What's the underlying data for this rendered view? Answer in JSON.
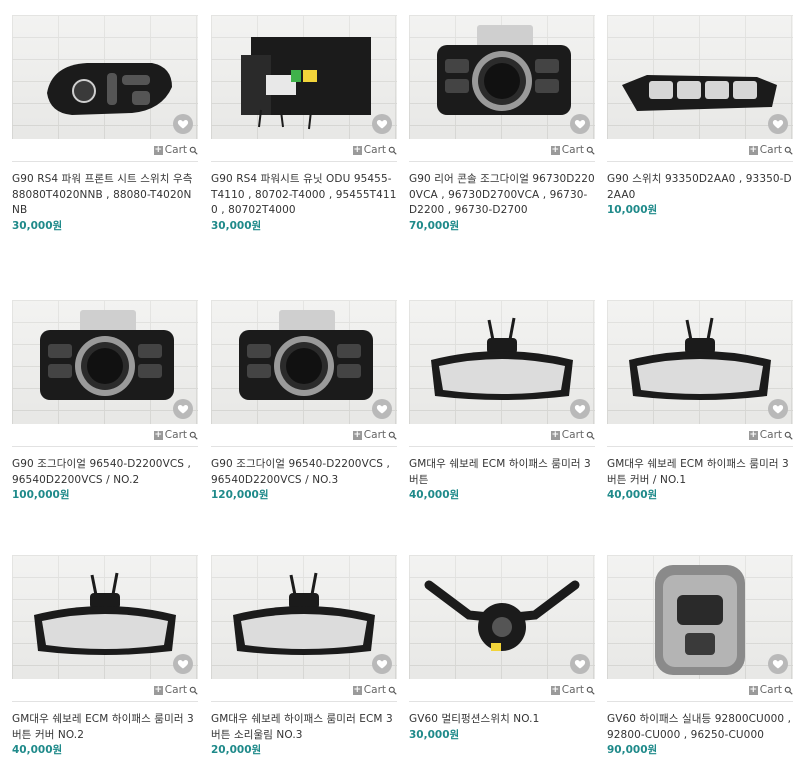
{
  "colors": {
    "price": "#1f8a8a",
    "heart_bg": "#b9b9b9",
    "text": "#333333"
  },
  "products": [
    {
      "title": "G90 RS4 파워 프론트 시트 스위치 우측 88080T4020NNB , 88080-T4020NNB",
      "price": "30,000원",
      "cart_label": "Cart",
      "icon": "seat-switch"
    },
    {
      "title": "G90 RS4 파워시트 유닛 ODU 95455-T4110 , 80702-T4000 , 95455T4110 , 80702T4000",
      "price": "30,000원",
      "cart_label": "Cart",
      "icon": "ecu-unit"
    },
    {
      "title": "G90 리어 콘솔 조그다이얼 96730D2200VCA , 96730D2700VCA , 96730-D2200 , 96730-D2700",
      "price": "70,000원",
      "cart_label": "Cart",
      "icon": "jog-dial"
    },
    {
      "title": "G90 스위치 93350D2AA0 , 93350-D2AA0",
      "price": "10,000원",
      "cart_label": "Cart",
      "icon": "switch-panel"
    },
    {
      "title": "G90 조그다이얼 96540-D2200VCS , 96540D2200VCS / NO.2",
      "price": "100,000원",
      "cart_label": "Cart",
      "icon": "jog-dial"
    },
    {
      "title": "G90 조그다이얼 96540-D2200VCS , 96540D2200VCS / NO.3",
      "price": "120,000원",
      "cart_label": "Cart",
      "icon": "jog-dial"
    },
    {
      "title": "GM대우 쉐보레 ECM 하이패스 룸미러 3버튼",
      "price": "40,000원",
      "cart_label": "Cart",
      "icon": "mirror"
    },
    {
      "title": "GM대우 쉐보레 ECM 하이패스 룸미러 3버튼 커버 / NO.1",
      "price": "40,000원",
      "cart_label": "Cart",
      "icon": "mirror"
    },
    {
      "title": "GM대우 쉐보레 ECM 하이패스 룸미러 3버튼 커버 NO.2",
      "price": "40,000원",
      "cart_label": "Cart",
      "icon": "mirror"
    },
    {
      "title": "GM대우 쉐보레 하이패스 룸미러 ECM 3버튼 소리울림 NO.3",
      "price": "20,000원",
      "cart_label": "Cart",
      "icon": "mirror"
    },
    {
      "title": "GV60 멀티펑션스위치 NO.1",
      "price": "30,000원",
      "cart_label": "Cart",
      "icon": "multifunction-switch"
    },
    {
      "title": "GV60 하이패스 실내등 92800CU000 , 92800-CU000 , 96250-CU000",
      "price": "90,000원",
      "cart_label": "Cart",
      "icon": "room-lamp"
    }
  ]
}
